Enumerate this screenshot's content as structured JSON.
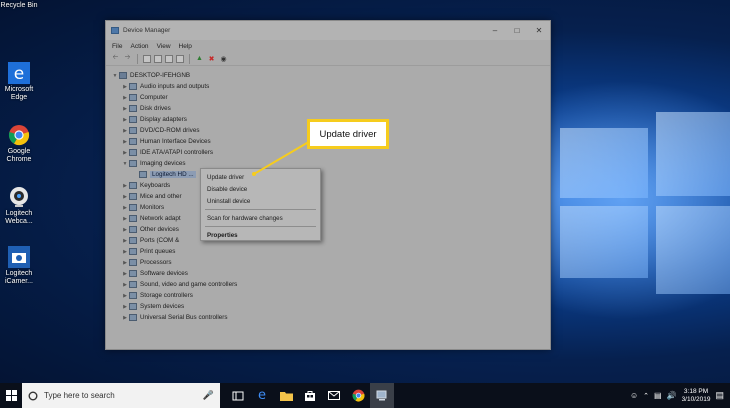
{
  "desktop": {
    "icons": [
      {
        "label": "Recycle Bin"
      },
      {
        "label": "Microsoft\nEdge"
      },
      {
        "label": "Google\nChrome"
      },
      {
        "label": "Logitech\nWebca..."
      },
      {
        "label": "Logitech\niCamer..."
      }
    ]
  },
  "window": {
    "title": "Device Manager",
    "menu": [
      "File",
      "Action",
      "View",
      "Help"
    ],
    "tree": {
      "root": "DESKTOP-IFEHGNB",
      "items": [
        "Audio inputs and outputs",
        "Computer",
        "Disk drives",
        "Display adapters",
        "DVD/CD-ROM drives",
        "Human Interface Devices",
        "IDE ATA/ATAPI controllers",
        "Imaging devices",
        "Logitech HD ...",
        "Keyboards",
        "Mice and other",
        "Monitors",
        "Network adapt",
        "Other devices",
        "Ports (COM &",
        "Print queues",
        "Processors",
        "Software devices",
        "Sound, video and game controllers",
        "Storage controllers",
        "System devices",
        "Universal Serial Bus controllers"
      ]
    }
  },
  "context_menu": {
    "items": [
      "Update driver",
      "Disable device",
      "Uninstall device",
      "Scan for hardware changes",
      "Properties"
    ]
  },
  "callout": {
    "text": "Update driver"
  },
  "taskbar": {
    "search_placeholder": "Type here to search",
    "time": "3:18 PM",
    "date": "3/10/2019"
  },
  "colors": {
    "callout_border": "#f6cc1d",
    "taskbar": "#0a0f1a"
  }
}
